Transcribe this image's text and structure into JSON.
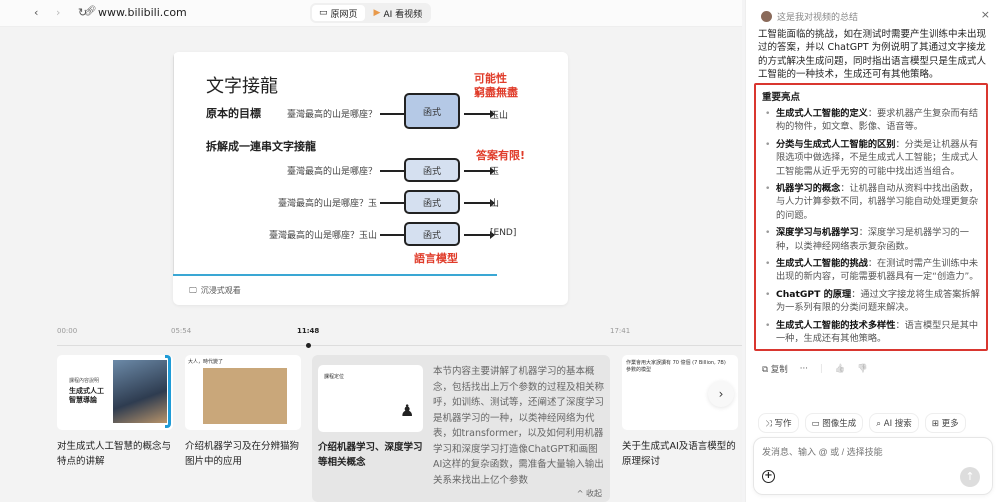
{
  "browser": {
    "url": "www.bilibili.com",
    "back": "‹",
    "forward": "›",
    "reload": "↻",
    "tabs": [
      {
        "label": "原网页"
      },
      {
        "label": "AI 看视频"
      }
    ]
  },
  "slide": {
    "title": "文字接龍",
    "goal_label": "原本的目標",
    "split_label": "拆解成一連串文字接龍",
    "question": "臺灣最高的山是哪座？",
    "q2": "臺灣最高的山是哪座？玉",
    "q3": "臺灣最高的山是哪座？玉山",
    "func": "函式",
    "out1": "玉山",
    "out2": "玉",
    "out3": "山",
    "out4": "[END]",
    "note1a": "可能性",
    "note1b": "窮盡無盡",
    "note2": "答案有限!",
    "note3": "語言模型"
  },
  "player": {
    "immersive": "沉浸式观看",
    "progress": 0.82
  },
  "timeline": {
    "marks": [
      "00:00",
      "05:54",
      "11:48",
      "17:41"
    ]
  },
  "chapters": [
    {
      "title": "对生成式人工智慧的概念与特点的讲解",
      "thumb_text": "課程內容說明",
      "thumb_big": "生成式人工智慧導論"
    },
    {
      "title": "介绍机器学习及在分辨猫狗图片中的应用",
      "thumb_text": "大人，時代變了"
    },
    {
      "title": "介绍机器学习、深度学习等相关概念",
      "thumb_text": "課程定位",
      "desc": "本节内容主要讲解了机器学习的基本概念，包括找出上万个参数的过程及相关称呼，如训练、测试等，还阐述了深度学习是机器学习的一种，以类神经网络为代表，如transformer，以及如何利用机器学习和深度学习打造像ChatGPT和画图AI这样的复杂函数，需准备大量输入输出关系来找出上亿个参数",
      "collapse": "^ 收起"
    },
    {
      "title": "关于生成式AI及语言模型的原理探讨",
      "thumb_text": "作業會用大家誤讀有 70 億個 (7 Billion, 7B) 參數的模型"
    }
  ],
  "next": "›",
  "panel": {
    "header": "这是我对视频的总结",
    "close": "×",
    "intro": "工智能面临的挑战，如在测试时需要产生训练中未出现过的答案，并以 ChatGPT 为例说明了其通过文字接龙的方式解决生成问题，同时指出语言模型只是生成式人工智能的一种技术，生成还可有其他策略。",
    "highlights_title": "重要亮点",
    "highlights": [
      {
        "term": "生成式人工智能的定义",
        "text": "：要求机器产生复杂而有结构的物件，如文章、影像、语音等。"
      },
      {
        "term": "分类与生成式人工智能的区别",
        "text": "：分类是让机器从有限选项中做选择，不是生成式人工智能；生成式人工智能需从近乎无穷的可能中找出适当组合。"
      },
      {
        "term": "机器学习的概念",
        "text": "：让机器自动从资料中找出函数，与人力计算参数不同，机器学习能自动处理更复杂的问题。"
      },
      {
        "term": "深度学习与机器学习",
        "text": "：深度学习是机器学习的一种，以类神经网络表示复杂函数。"
      },
      {
        "term": "生成式人工智能的挑战",
        "text": "：在测试时需产生训练中未出现的新内容，可能需要机器具有一定“创造力”。"
      },
      {
        "term": "ChatGPT 的原理",
        "text": "：通过文字接龙将生成答案拆解为一系列有限的分类问题来解决。"
      },
      {
        "term": "生成式人工智能的技术多样性",
        "text": "：语言模型只是其中一种，生成还有其他策略。"
      }
    ],
    "actions": {
      "copy": "复制",
      "more": "···",
      "like": "👍",
      "dislike": "👎"
    },
    "chips": [
      "写作",
      "图像生成",
      "AI 搜索",
      "更多"
    ],
    "chip_icons": [
      "⤨",
      "▭",
      "⌕",
      "⊞"
    ],
    "input_placeholder": "发消息、输入 @ 或 / 选择技能",
    "plus": "+",
    "send": "↑"
  },
  "colors": {
    "accent": "#d9362f",
    "progress": "#3aa7d4"
  }
}
